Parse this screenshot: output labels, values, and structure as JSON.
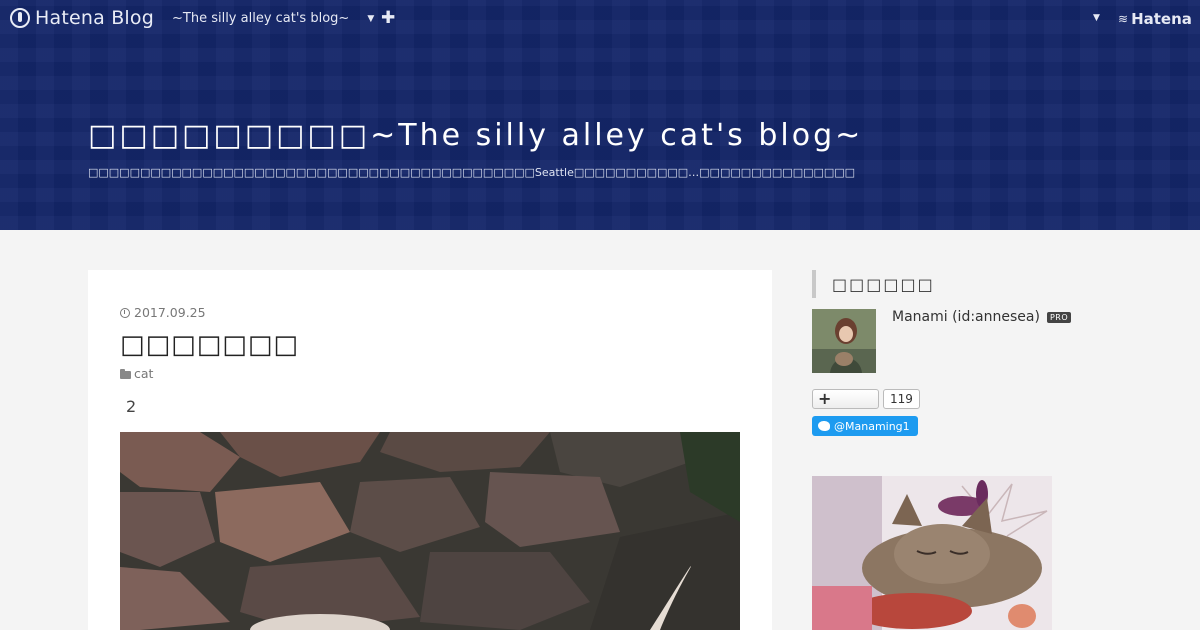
{
  "header": {
    "logo_text": "Hatena Blog",
    "blog_selector": "~The silly alley cat's blog~",
    "add_icon": "plus-icon",
    "brand_right": "Hatena"
  },
  "blog": {
    "title": "□□□□□□□□□~The silly alley cat's blog~",
    "description": "□□□□□□□□□□□□□□□□□□□□□□□□□□□□□□□□□□□□□□□□□□□Seattle□□□□□□□□□□□…□□□□□□□□□□□□□□□"
  },
  "entry": {
    "date": "2017.09.25",
    "title": "□□□□□□□",
    "category": "cat",
    "body_text": "2"
  },
  "sidebar": {
    "heading": "□□□□□□",
    "profile_name": "Manami (id:annesea)",
    "pro_badge": "PRO",
    "readers_count": "119",
    "twitter_handle": "@Manaming1"
  },
  "colors": {
    "header_bg": "#142669",
    "page_bg": "#f4f4f4",
    "twitter": "#1d9bf0"
  }
}
